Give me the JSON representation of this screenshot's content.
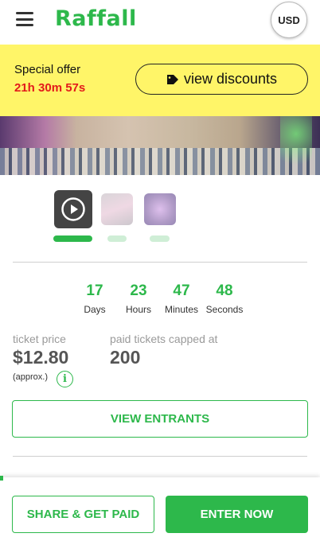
{
  "header": {
    "logo": "Raffall",
    "currency": "USD"
  },
  "offer": {
    "title": "Special offer",
    "timer": "21h 30m 57s",
    "button_label": "view discounts"
  },
  "countdown": [
    {
      "value": "17",
      "unit": "Days"
    },
    {
      "value": "23",
      "unit": "Hours"
    },
    {
      "value": "47",
      "unit": "Minutes"
    },
    {
      "value": "48",
      "unit": "Seconds"
    }
  ],
  "pricing": {
    "ticket_price_label": "ticket price",
    "ticket_price": "$12.80",
    "approx_label": "(approx.)",
    "cap_label": "paid tickets capped at",
    "cap_value": "200"
  },
  "actions": {
    "view_entrants": "VIEW ENTRANTS",
    "share": "SHARE & GET PAID",
    "enter": "ENTER NOW"
  },
  "colors": {
    "brand_green": "#2db84b",
    "offer_yellow": "#fff568",
    "timer_red": "#e31b1b"
  }
}
